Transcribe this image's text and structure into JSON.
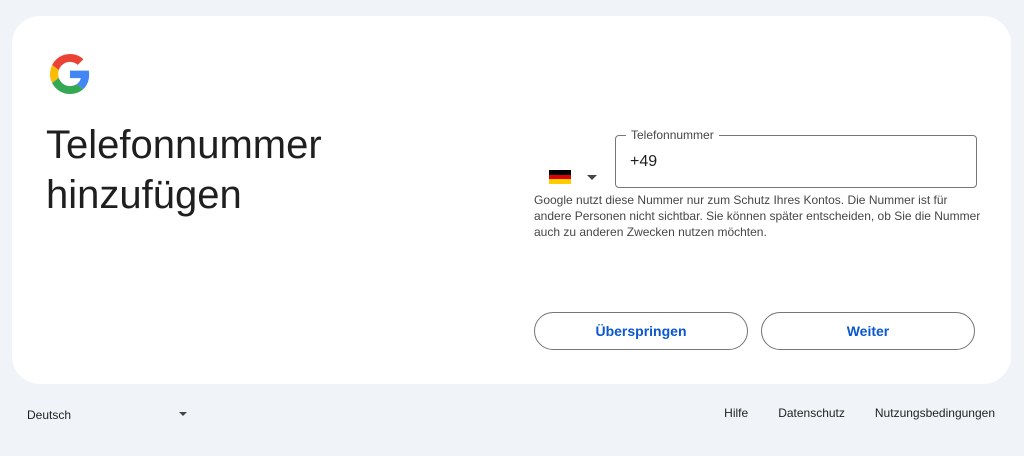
{
  "page": {
    "title": "Telefonnummer hinzufügen"
  },
  "brand": {
    "logo_icon": "google-g-icon",
    "colors": {
      "blue": "#4285F4",
      "red": "#EA4335",
      "yellow": "#FBBC05",
      "green": "#34A853",
      "accent": "#0b57d0"
    }
  },
  "country": {
    "flag_icon": "germany-flag-icon",
    "flag_colors": [
      "#000000",
      "#DD0000",
      "#FFCE00"
    ]
  },
  "phone": {
    "label": "Telefonnummer",
    "value": "+49"
  },
  "hint": "Google nutzt diese Nummer nur zum Schutz Ihres Kontos. Die Nummer ist für andere Personen nicht sichtbar. Sie können später entscheiden, ob Sie die Nummer auch zu anderen Zwecken nutzen möchten.",
  "actions": {
    "skip_label": "Überspringen",
    "next_label": "Weiter"
  },
  "footer": {
    "language": "Deutsch",
    "links": {
      "help": "Hilfe",
      "privacy": "Datenschutz",
      "terms": "Nutzungsbedingungen"
    }
  }
}
